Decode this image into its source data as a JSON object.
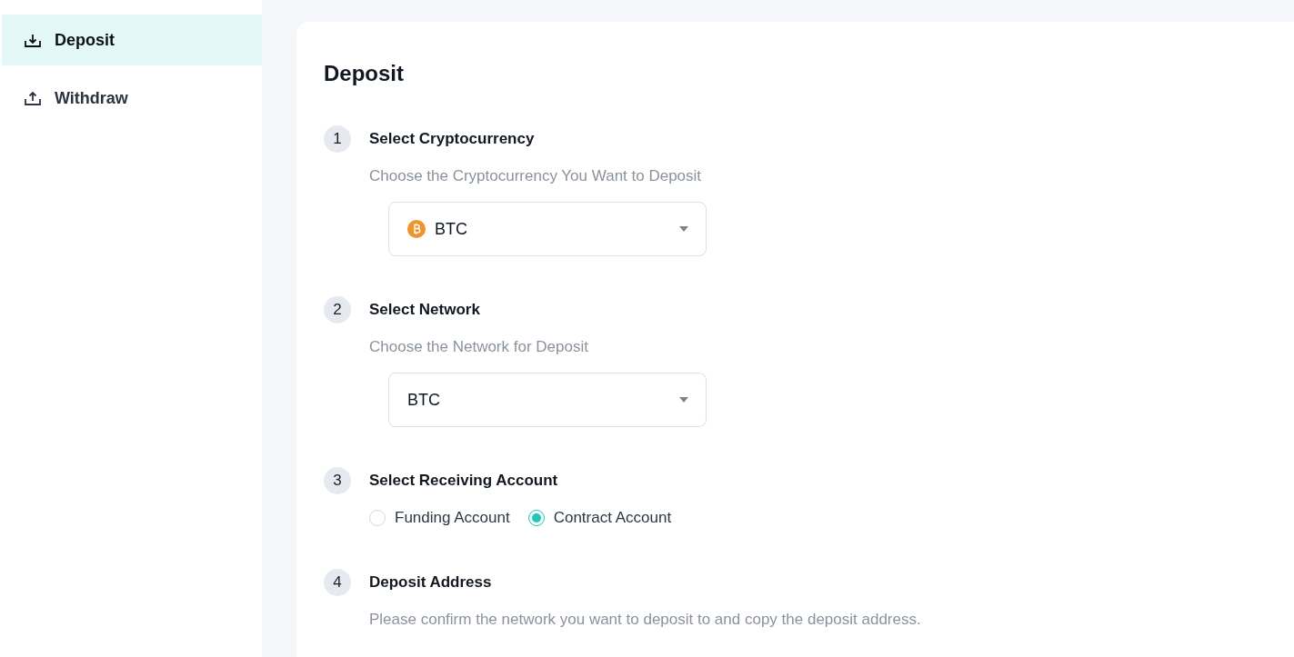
{
  "sidebar": {
    "items": [
      {
        "label": "Deposit",
        "kind": "download",
        "selected": true
      },
      {
        "label": "Withdraw",
        "kind": "upload",
        "selected": false
      }
    ]
  },
  "card": {
    "title": "Deposit",
    "steps": [
      {
        "number": "1",
        "title": "Select Cryptocurrency",
        "description": "Choose the Cryptocurrency You Want to Deposit",
        "kind": "select",
        "select": {
          "value": "BTC",
          "coin_icon": true
        }
      },
      {
        "number": "2",
        "title": "Select Network",
        "description": "Choose the Network for Deposit",
        "kind": "select",
        "select": {
          "value": "BTC",
          "coin_icon": false
        }
      },
      {
        "number": "3",
        "title": "Select Receiving Account",
        "kind": "radio",
        "options": [
          {
            "label": "Funding Account",
            "selected": false
          },
          {
            "label": "Contract Account",
            "selected": true
          }
        ]
      },
      {
        "number": "4",
        "title": "Deposit Address",
        "description": "Please confirm the network you want to deposit to and copy the deposit address.",
        "kind": "text"
      }
    ]
  }
}
